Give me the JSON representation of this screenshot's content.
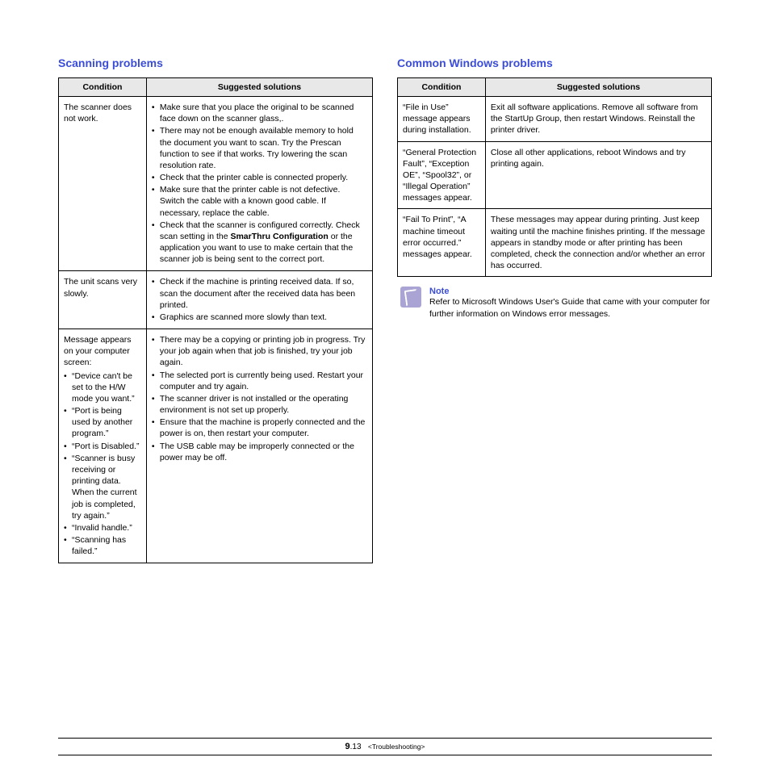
{
  "left": {
    "heading": "Scanning problems",
    "th1": "Condition",
    "th2": "Suggested solutions",
    "rows": [
      {
        "cond_plain": "The scanner does not work.",
        "sol": [
          "Make sure that you place the original to be scanned face down on the scanner glass,.",
          "There may not be enough available memory to hold the document you want to scan. Try the Prescan function to see if that works. Try lowering the scan resolution rate.",
          "Check that the printer cable is connected properly.",
          "Make sure that the printer cable is not defective. Switch the cable with a known good cable. If necessary, replace the cable.",
          {
            "pre": "Check that the scanner is configured correctly. Check scan setting in the ",
            "bold": "SmarThru Configuration",
            "post": " or the application you want to use to make certain that the scanner job is being sent to the correct port."
          }
        ]
      },
      {
        "cond_plain": "The unit scans very slowly.",
        "sol": [
          "Check if the machine is printing received data. If so, scan the document after the received data has been printed.",
          "Graphics are scanned more slowly than text."
        ]
      },
      {
        "cond_intro": "Message appears on your computer screen:",
        "cond_list": [
          "“Device can't be set to the H/W mode you want.”",
          "“Port is being used by another program.”",
          "“Port is Disabled.”",
          "“Scanner is busy receiving or printing data. When the current job is completed, try again.”",
          "“Invalid handle.”",
          "“Scanning has failed.”"
        ],
        "sol": [
          "There may be a copying or printing job in progress. Try your job again when that job is finished, try your job again.",
          "The selected port is currently being used. Restart your computer and try again.",
          "The scanner driver is not installed or the operating environment is not set up properly.",
          "Ensure that the machine is properly connected and the power is on, then restart your computer.",
          "The USB cable may be improperly connected or the power may be off."
        ]
      }
    ]
  },
  "right": {
    "heading": "Common Windows problems",
    "th1": "Condition",
    "th2": "Suggested solutions",
    "rows": [
      {
        "cond": "“File in Use” message appears during installation.",
        "sol": "Exit all software applications. Remove all software from the StartUp Group, then restart Windows. Reinstall the printer driver."
      },
      {
        "cond": "“General Protection Fault”, “Exception OE”, “Spool32”, or “Illegal Operation” messages appear.",
        "sol": "Close all other applications, reboot Windows and try printing again."
      },
      {
        "cond": "“Fail To Print”, “A machine timeout error occurred.” messages appear.",
        "sol": "These messages may appear during printing. Just keep waiting until the machine finishes printing. If the message appears in standby mode or after printing has been completed, check the connection and/or whether an error has occurred."
      }
    ],
    "note_title": "Note",
    "note_body": "Refer to Microsoft Windows User's Guide that came with your computer for further information on Windows error messages."
  },
  "footer": {
    "chapter": "9",
    "page": ".13",
    "section": "<Troubleshooting>"
  }
}
